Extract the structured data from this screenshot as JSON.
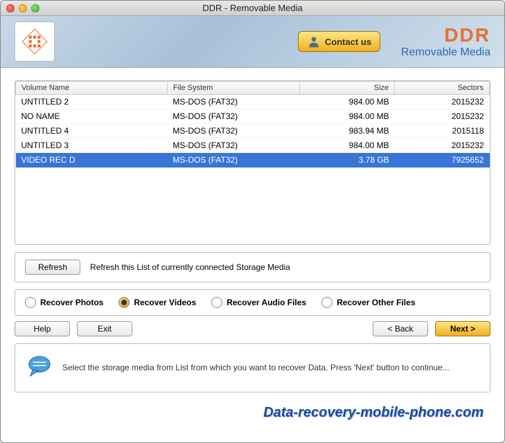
{
  "window": {
    "title": "DDR - Removable Media"
  },
  "header": {
    "contact_label": "Contact us",
    "brand_title": "DDR",
    "brand_sub": "Removable Media"
  },
  "table": {
    "columns": [
      "Volume Name",
      "File System",
      "Size",
      "Sectors"
    ],
    "rows": [
      {
        "volume": "UNTITLED 2",
        "fs": "MS-DOS (FAT32)",
        "size": "984.00  MB",
        "sectors": "2015232",
        "selected": false
      },
      {
        "volume": "NO NAME",
        "fs": "MS-DOS (FAT32)",
        "size": "984.00  MB",
        "sectors": "2015232",
        "selected": false
      },
      {
        "volume": "UNTITLED 4",
        "fs": "MS-DOS (FAT32)",
        "size": "983.94  MB",
        "sectors": "2015118",
        "selected": false
      },
      {
        "volume": "UNTITLED 3",
        "fs": "MS-DOS (FAT32)",
        "size": "984.00  MB",
        "sectors": "2015232",
        "selected": false
      },
      {
        "volume": "VIDEO REC D",
        "fs": "MS-DOS (FAT32)",
        "size": "3.78  GB",
        "sectors": "7925652",
        "selected": true
      }
    ]
  },
  "refresh": {
    "button": "Refresh",
    "hint": "Refresh this List of currently connected Storage Media"
  },
  "recover_options": [
    {
      "label": "Recover Photos",
      "selected": false
    },
    {
      "label": "Recover Videos",
      "selected": true
    },
    {
      "label": "Recover Audio Files",
      "selected": false
    },
    {
      "label": "Recover Other Files",
      "selected": false
    }
  ],
  "nav": {
    "help": "Help",
    "exit": "Exit",
    "back": "< Back",
    "next": "Next >"
  },
  "hint": "Select the storage media from List from which you want to recover Data. Press 'Next' button to continue...",
  "footer": "Data-recovery-mobile-phone.com"
}
